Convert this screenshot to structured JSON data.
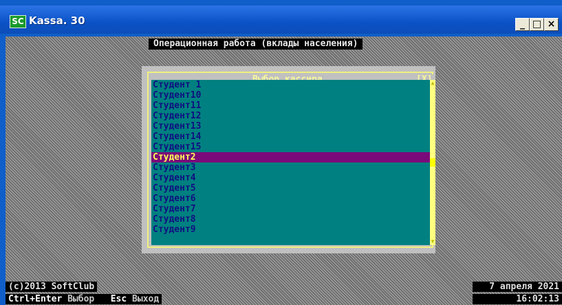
{
  "window": {
    "title": "Kassa. 30",
    "icon_label": "SC",
    "buttons": {
      "minimize": "_",
      "maximize": "□",
      "close": "×"
    }
  },
  "console": {
    "menu_title": "Операционная работа (вклады населения)"
  },
  "dialog": {
    "title": "Выбор кассира",
    "close_label": "[X]",
    "scroll_up": "▲",
    "scroll_down": "▼",
    "items": [
      {
        "label": "Студент 1"
      },
      {
        "label": "Студент10"
      },
      {
        "label": "Студент11"
      },
      {
        "label": "Студент12"
      },
      {
        "label": "Студент13"
      },
      {
        "label": "Студент14"
      },
      {
        "label": "Студент15"
      },
      {
        "label": "Студент2"
      },
      {
        "label": "Студент3"
      },
      {
        "label": "Студент4"
      },
      {
        "label": "Студент5"
      },
      {
        "label": "Студент6"
      },
      {
        "label": "Студент7"
      },
      {
        "label": "Студент8"
      },
      {
        "label": "Студент9"
      }
    ],
    "selected_index": 7
  },
  "status": {
    "copyright": "(c)2013 SoftClub",
    "date": "7 апреля 2021",
    "time": "16:02:13",
    "hotkeys": [
      {
        "key": "Ctrl+Enter",
        "action": "Выбор"
      },
      {
        "key": "Esc",
        "action": "Выход"
      }
    ]
  },
  "colors": {
    "titlebar": "#0b52c6",
    "list_bg": "#008080",
    "list_text": "#101080",
    "selected_bg": "#7a0a7a",
    "selected_text": "#ffff55",
    "frame": "#f0f080"
  }
}
